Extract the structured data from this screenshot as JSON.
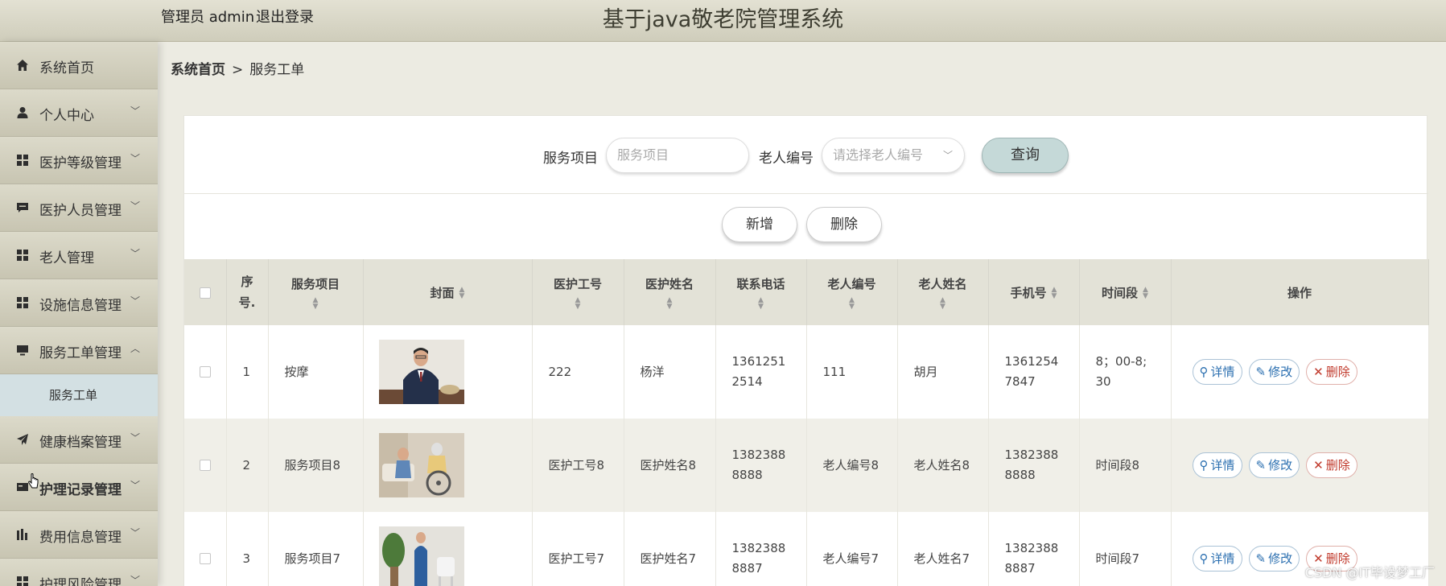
{
  "header": {
    "user_label": "管理员 admin",
    "logout_label": "退出登录",
    "title": "基于java敬老院管理系统"
  },
  "sidebar": {
    "items": [
      {
        "label": "系统首页",
        "icon": "home-icon",
        "arrow": ""
      },
      {
        "label": "个人中心",
        "icon": "person-icon",
        "arrow": "﹀"
      },
      {
        "label": "医护等级管理",
        "icon": "grid-icon",
        "arrow": "﹀"
      },
      {
        "label": "医护人员管理",
        "icon": "chat-icon",
        "arrow": "﹀"
      },
      {
        "label": "老人管理",
        "icon": "grid-icon",
        "arrow": "﹀"
      },
      {
        "label": "设施信息管理",
        "icon": "grid-icon",
        "arrow": "﹀"
      },
      {
        "label": "服务工单管理",
        "icon": "monitor-icon",
        "arrow": "︿"
      },
      {
        "label": "健康档案管理",
        "icon": "send-icon",
        "arrow": "﹀"
      },
      {
        "label": "护理记录管理",
        "icon": "card-icon",
        "arrow": "﹀"
      },
      {
        "label": "费用信息管理",
        "icon": "chart-icon",
        "arrow": "﹀"
      },
      {
        "label": "护理风险管理",
        "icon": "grid-icon",
        "arrow": "﹀"
      }
    ],
    "sub_item": "服务工单"
  },
  "breadcrumb": {
    "home": "系统首页",
    "separator": ">",
    "current": "服务工单"
  },
  "search": {
    "project_label": "服务项目",
    "project_placeholder": "服务项目",
    "elder_label": "老人编号",
    "elder_placeholder": "请选择老人编号",
    "query_button": "查询"
  },
  "actions": {
    "add": "新增",
    "delete": "删除"
  },
  "table": {
    "headers": {
      "index": "序号.",
      "project": "服务项目",
      "cover": "封面",
      "staff_no": "医护工号",
      "staff_name": "医护姓名",
      "contact": "联系电话",
      "elder_no": "老人编号",
      "elder_name": "老人姓名",
      "phone": "手机号",
      "period": "时间段",
      "ops": "操作"
    },
    "rows": [
      {
        "index": "1",
        "project": "按摩",
        "staff_no": "222",
        "staff_name": "杨洋",
        "contact": "13612512514",
        "elder_no": "111",
        "elder_name": "胡月",
        "phone": "13612547847",
        "period": "8；00-8;30"
      },
      {
        "index": "2",
        "project": "服务项目8",
        "staff_no": "医护工号8",
        "staff_name": "医护姓名8",
        "contact": "13823888888",
        "elder_no": "老人编号8",
        "elder_name": "老人姓名8",
        "phone": "13823888888",
        "period": "时间段8"
      },
      {
        "index": "3",
        "project": "服务项目7",
        "staff_no": "医护工号7",
        "staff_name": "医护姓名7",
        "contact": "13823888887",
        "elder_no": "老人编号7",
        "elder_name": "老人姓名7",
        "phone": "13823888887",
        "period": "时间段7"
      }
    ],
    "op_labels": {
      "detail": "详情",
      "edit": "修改",
      "delete": "删除"
    }
  },
  "watermark": "CSDN @IT毕设梦工厂"
}
